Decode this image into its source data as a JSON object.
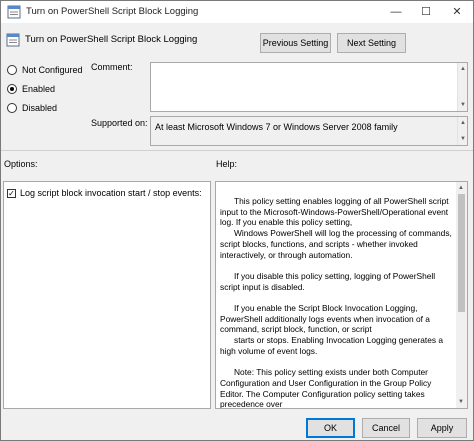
{
  "window": {
    "title": "Turn on PowerShell Script Block Logging",
    "icon": "policy-setting-icon",
    "controls": {
      "minimize": "—",
      "maximize": "☐",
      "close": "✕"
    }
  },
  "header": {
    "title": "Turn on PowerShell Script Block Logging",
    "prev_label": "Previous Setting",
    "next_label": "Next Setting"
  },
  "state": {
    "options": [
      {
        "label": "Not Configured",
        "selected": false
      },
      {
        "label": "Enabled",
        "selected": true
      },
      {
        "label": "Disabled",
        "selected": false
      }
    ]
  },
  "comment": {
    "label": "Comment:",
    "value": ""
  },
  "supported": {
    "label": "Supported on:",
    "value": "At least Microsoft Windows 7 or Windows Server 2008 family"
  },
  "options_panel": {
    "label": "Options:",
    "checkbox_label": "Log script block invocation start / stop events:",
    "checked": true
  },
  "help_panel": {
    "label": "Help:",
    "paragraphs": [
      "This policy setting enables logging of all PowerShell script input to the Microsoft-Windows-PowerShell/Operational event log. If you enable this policy setting,",
      "Windows PowerShell will log the processing of commands, script blocks, functions, and scripts - whether invoked interactively, or through automation.",
      "If you disable this policy setting, logging of PowerShell script input is disabled.",
      "If you enable the Script Block Invocation Logging, PowerShell additionally logs events when invocation of a command, script block, function, or script",
      "starts or stops. Enabling Invocation Logging generates a high volume of event logs.",
      "Note: This policy setting exists under both Computer Configuration and User Configuration in the Group Policy Editor. The Computer Configuration policy setting takes precedence over"
    ]
  },
  "footer": {
    "ok_label": "OK",
    "cancel_label": "Cancel",
    "apply_label": "Apply"
  },
  "colors": {
    "accent": "#0078d7",
    "panel_border": "#a9a9a9",
    "button_face": "#e1e1e1"
  }
}
